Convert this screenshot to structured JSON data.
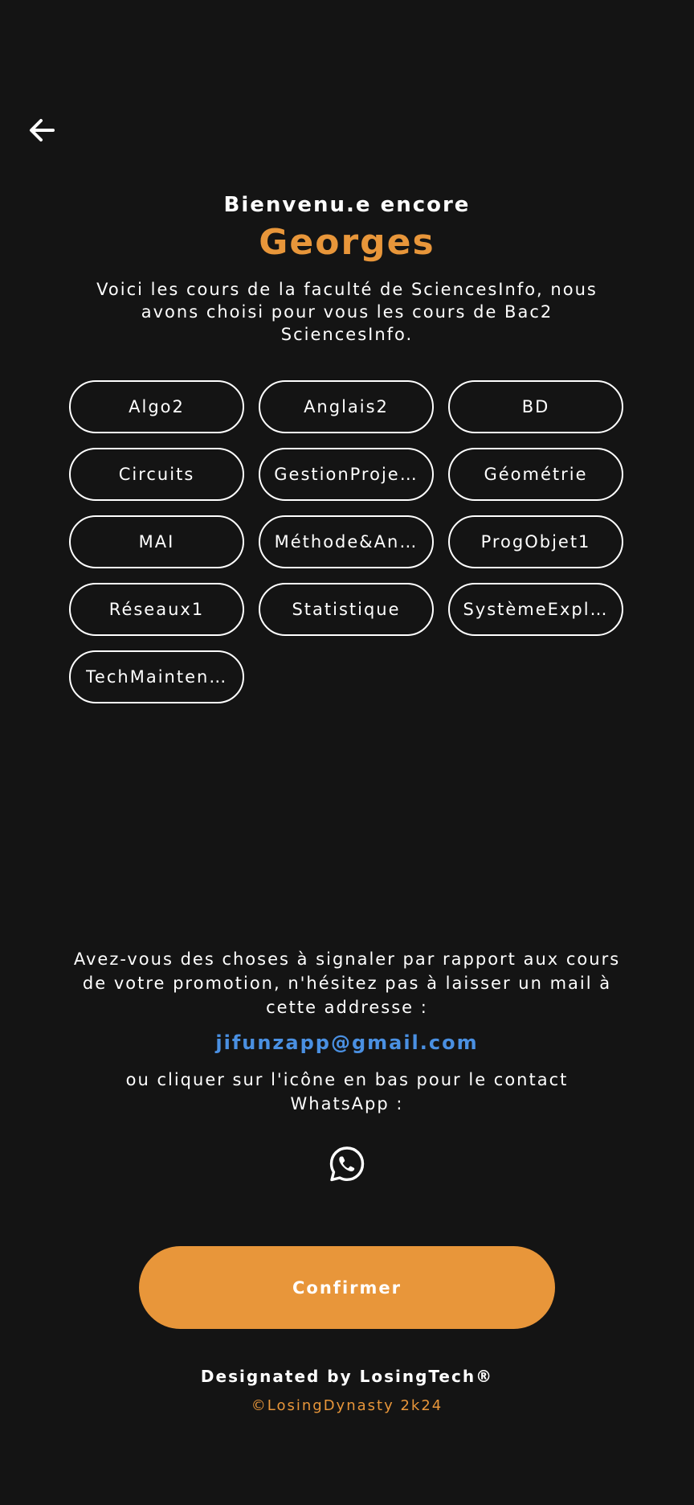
{
  "header": {
    "back_icon": "arrow-left-icon"
  },
  "welcome": {
    "greeting": "Bienvenu.e encore",
    "username": "Georges",
    "intro": "Voici les cours de la faculté de SciencesInfo, nous avons choisi pour vous les cours de Bac2 SciencesInfo."
  },
  "courses": [
    {
      "label": "Algo2"
    },
    {
      "label": "Anglais2"
    },
    {
      "label": "BD"
    },
    {
      "label": "Circuits"
    },
    {
      "label": "GestionProje…"
    },
    {
      "label": "Géométrie"
    },
    {
      "label": "MAI"
    },
    {
      "label": "Méthode&An…"
    },
    {
      "label": "ProgObjet1"
    },
    {
      "label": "Réseaux1"
    },
    {
      "label": "Statistique"
    },
    {
      "label": "SystèmeExpl…"
    },
    {
      "label": "TechMainten…"
    }
  ],
  "contact": {
    "report_text": "Avez-vous des choses à signaler par rapport aux cours de votre promotion, n'hésitez pas à laisser un mail à cette addresse :",
    "email": "jifunzapp@gmail.com",
    "whatsapp_text": "ou cliquer sur l'icône en bas pour le contact WhatsApp :",
    "whatsapp_icon": "whatsapp-icon"
  },
  "actions": {
    "confirm_label": "Confirmer"
  },
  "footer": {
    "designed_by": "Designated by LosingTech®",
    "copyright": "©LosingDynasty 2k24"
  },
  "colors": {
    "background": "#141414",
    "accent": "#e8963a",
    "link": "#4a90e2",
    "text": "#ffffff"
  }
}
